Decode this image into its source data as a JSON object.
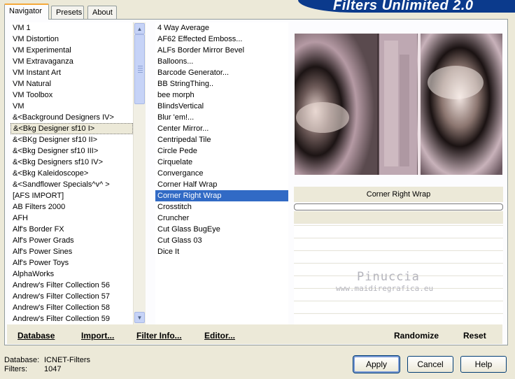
{
  "title": "Filters Unlimited 2.0",
  "tabs": [
    {
      "label": "Navigator"
    },
    {
      "label": "Presets"
    },
    {
      "label": "About"
    }
  ],
  "categories": {
    "items": [
      "VM 1",
      "VM Distortion",
      "VM Experimental",
      "VM Extravaganza",
      "VM Instant Art",
      "VM Natural",
      "VM Toolbox",
      "VM",
      "&<Background Designers IV>",
      "&<Bkg Designer sf10 I>",
      "&<BKg Designer sf10 II>",
      "&<Bkg Designer sf10 III>",
      "&<Bkg Designers sf10 IV>",
      "&<Bkg Kaleidoscope>",
      "&<Sandflower Specials^v^ >",
      "[AFS IMPORT]",
      "AB Filters 2000",
      "AFH",
      "Alf's Border FX",
      "Alf's Power Grads",
      "Alf's Power Sines",
      "Alf's Power Toys",
      "AlphaWorks",
      "Andrew's Filter Collection 56",
      "Andrew's Filter Collection 57",
      "Andrew's Filter Collection 58",
      "Andrew's Filter Collection 59"
    ],
    "selected_index": 9
  },
  "filters": {
    "items": [
      "4 Way Average",
      "AF62 Effected Emboss...",
      "ALFs Border Mirror Bevel",
      "Balloons...",
      "Barcode Generator...",
      "BB StringThing..",
      "bee morph",
      "BlindsVertical",
      "Blur 'em!...",
      "Center Mirror...",
      "Centripedal Tile",
      "Circle Pede",
      "Cirquelate",
      "Convergance",
      "Corner Half Wrap",
      "Corner Right Wrap",
      "Crosstitch",
      "Cruncher",
      "Cut Glass  BugEye",
      "Cut Glass 03",
      "Dice It"
    ],
    "selected_index": 15
  },
  "selected_filter_name": "Corner Right Wrap",
  "bottom_links": {
    "database": "Database",
    "import": "Import...",
    "filter_info": "Filter Info...",
    "editor": "Editor...",
    "randomize": "Randomize",
    "reset": "Reset"
  },
  "status": {
    "database_label": "Database:",
    "database_value": "ICNET-Filters",
    "filters_label": "Filters:",
    "filters_value": "1047"
  },
  "buttons": {
    "apply": "Apply",
    "cancel": "Cancel",
    "help": "Help"
  },
  "watermark": {
    "name": "Pinuccia",
    "url": "www.maidiregrafica.eu"
  },
  "colors": {
    "banner": "#0b3a8c",
    "selection": "#316ac5",
    "window": "#ece9d8"
  }
}
